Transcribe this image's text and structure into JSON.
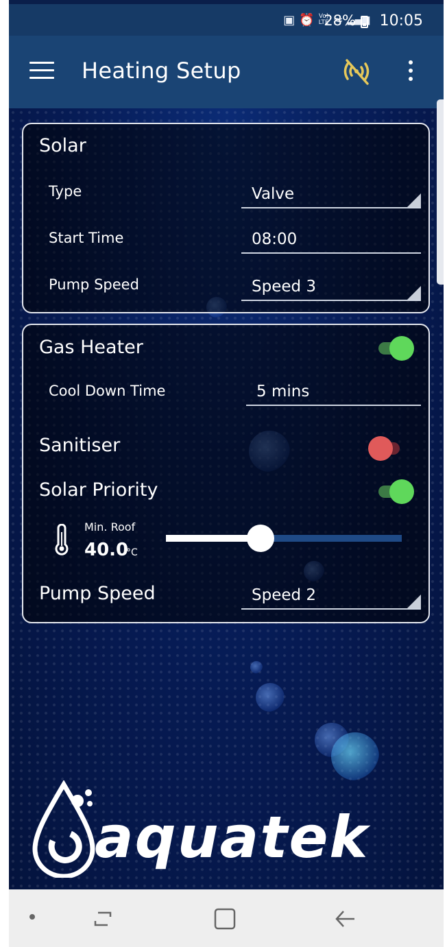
{
  "status_bar": {
    "network_label": "LTE",
    "volte_label": "Vo)",
    "battery_percent": "28%",
    "time": "10:05"
  },
  "app_bar": {
    "title": "Heating Setup"
  },
  "solar": {
    "title": "Solar",
    "type": {
      "label": "Type",
      "value": "Valve"
    },
    "start_time": {
      "label": "Start Time",
      "value": "08:00"
    },
    "pump_speed": {
      "label": "Pump Speed",
      "value": "Speed 3"
    }
  },
  "gas_heater": {
    "title": "Gas Heater",
    "enabled": true,
    "cool_down": {
      "label": "Cool Down Time",
      "value": "5 mins"
    },
    "sanitiser": {
      "label": "Sanitiser",
      "enabled": false
    },
    "solar_priority": {
      "label": "Solar Priority",
      "enabled": true
    },
    "min_roof": {
      "label": "Min. Roof",
      "value": "40.0",
      "unit": "°C",
      "slider_fraction": 0.4
    },
    "pump_speed": {
      "label": "Pump Speed",
      "value": "Speed 2"
    }
  },
  "logo": {
    "text": "aquatek"
  },
  "colors": {
    "toggle_on": "#5fd85b",
    "toggle_off": "#e05a5a",
    "app_bar": "#1a4474",
    "warning_icon": "#e6c85a"
  }
}
